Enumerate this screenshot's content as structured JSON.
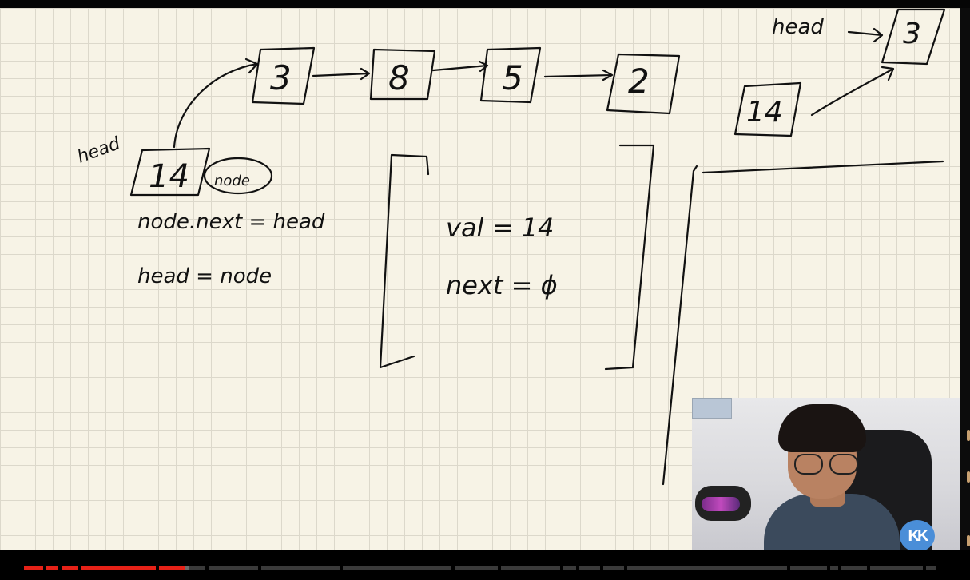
{
  "video": {
    "board": {
      "linked_list_top": [
        "3",
        "8",
        "5",
        "2"
      ],
      "new_node_value": "14",
      "new_node_label": "node",
      "head_label_left": "head",
      "step_1": "node.next = head",
      "step_2": "head = node",
      "node_fields": {
        "val_line": "val = 14",
        "next_line": "next = ϕ"
      },
      "right_diagram": {
        "head_label": "head",
        "head_node": "3",
        "new_node": "14"
      }
    },
    "channel_logo": "KK",
    "progress": {
      "played_fraction": 0.19,
      "played_color": "#e62117",
      "unplayed_color": "#3a3a3a",
      "buffered_color": "#6b6b6b"
    }
  },
  "icons": {
    "logo": "kk-logo-icon"
  }
}
